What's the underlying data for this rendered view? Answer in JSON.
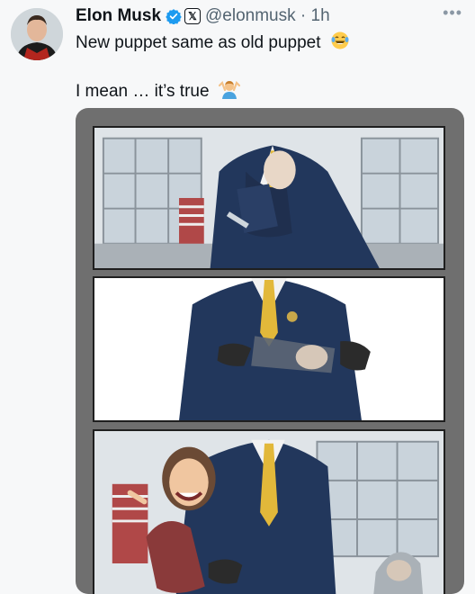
{
  "tweet": {
    "display_name": "Elon Musk",
    "handle_line": "@elonmusk · 1h",
    "line1": "New puppet same as old puppet",
    "line2": "I mean … it’s true",
    "more_glyph": "•••"
  },
  "icons": {
    "verified": "verified-badge-icon",
    "x_logo": "x-logo-icon",
    "laugh": "face-with-tears-of-joy-icon",
    "shrug": "person-shrugging-icon",
    "more": "more-options-icon"
  },
  "media": {
    "panels": [
      "three-panel-cartoon-panel-1",
      "three-panel-cartoon-panel-2",
      "three-panel-cartoon-panel-3"
    ]
  },
  "colors": {
    "verified_blue": "#1d9bf0",
    "suit_navy": "#22375c",
    "tie_gold": "#e2b83a",
    "handle_gray": "#536471"
  }
}
